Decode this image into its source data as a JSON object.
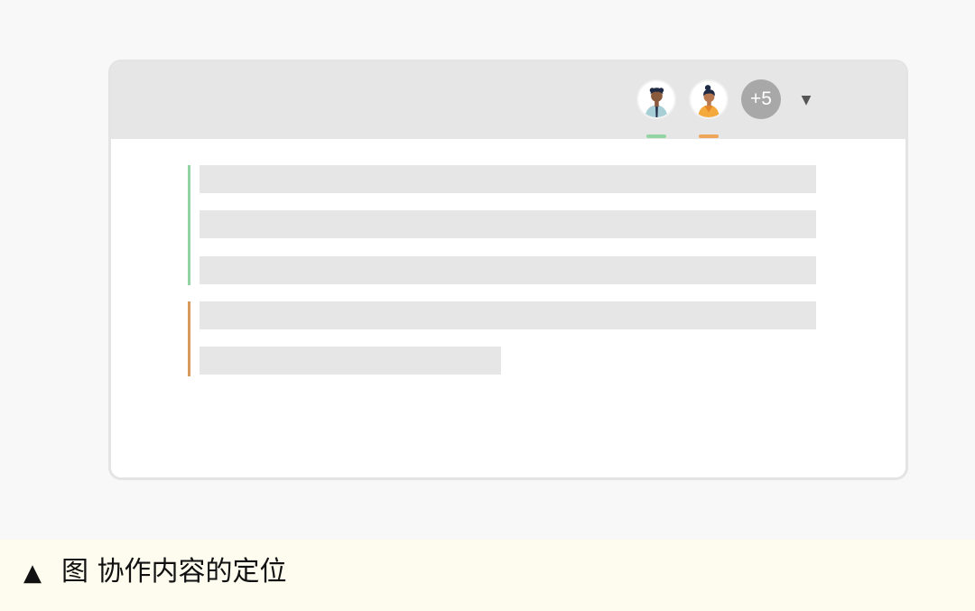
{
  "header": {
    "collaborators": [
      {
        "icon": "avatar-man-icon",
        "presence_color": "#93d5a2"
      },
      {
        "icon": "avatar-woman-icon",
        "presence_color": "#efa65a"
      }
    ],
    "more_count": "+5",
    "dropdown_icon": "▼"
  },
  "document": {
    "sections": [
      {
        "editor_color": "#93d5a2",
        "lines": 3
      },
      {
        "editor_color": "#d79a5c",
        "lines": 2
      }
    ]
  },
  "caption": {
    "icon": "▲",
    "text": "图 协作内容的定位"
  },
  "colors": {
    "background": "#f8f8f8",
    "header_bg": "#e6e6e6",
    "placeholder_line": "#e6e6e6",
    "badge_bg": "#a8a8a8",
    "caption_bg": "#fefcee"
  }
}
